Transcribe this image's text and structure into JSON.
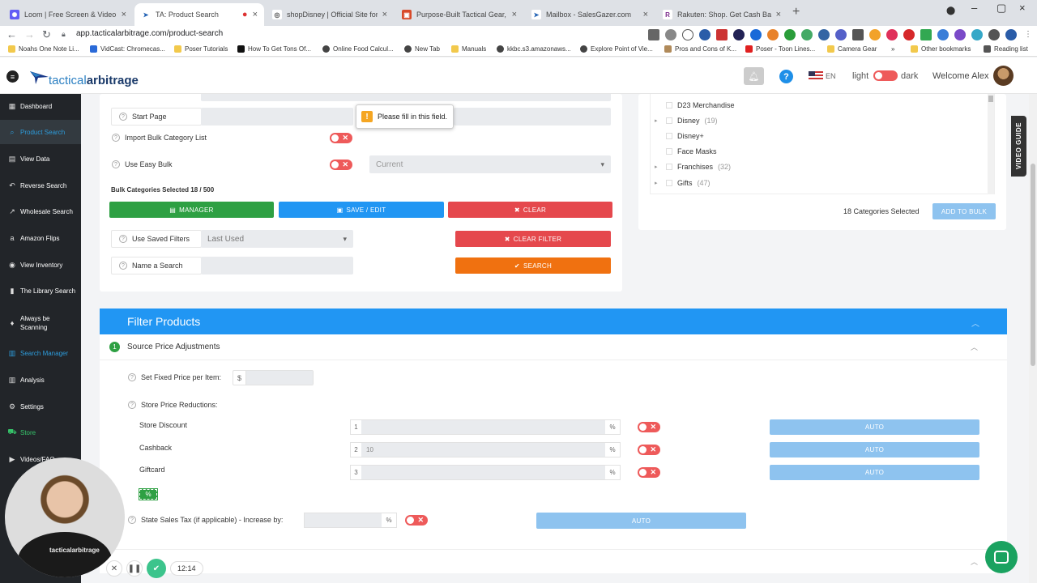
{
  "tabs": [
    {
      "title": "Loom | Free Screen & Video Rec",
      "color": "#625df5",
      "glyph": "✺"
    },
    {
      "title": "TA: Product Search",
      "color": "#1e5fb3",
      "glyph": "➤"
    },
    {
      "title": "shopDisney | Official Site for Disn",
      "color": "#555555",
      "glyph": "◎"
    },
    {
      "title": "Purpose-Built Tactical Gear, Appa",
      "color": "#d84a2a",
      "glyph": "▣"
    },
    {
      "title": "Mailbox - SalesGazer.com",
      "color": "#1e5fb3",
      "glyph": "➤"
    },
    {
      "title": "Rakuten: Shop. Get Cash Back. Re",
      "color": "#7b2a8c",
      "glyph": "R"
    }
  ],
  "browser": {
    "url": "app.tacticalarbitrage.com/product-search",
    "other_bookmarks": "Other bookmarks",
    "reading_list": "Reading list"
  },
  "bookmarks": [
    "Noahs One Note Li...",
    "VidCast: Chromecas...",
    "Poser Tutorials",
    "How To Get Tons Of...",
    "Online Food Calcul...",
    "New Tab",
    "Manuals",
    "kkbc.s3.amazonaws...",
    "Explore Point of Vie...",
    "Pros and Cons of K...",
    "Poser - Toon Lines...",
    "Camera Gear"
  ],
  "header": {
    "logo_a": "tactical",
    "logo_b": "arbitrage",
    "lang": "EN",
    "light": "light",
    "dark": "dark",
    "welcome": "Welcome Alex"
  },
  "sidebar": [
    {
      "label": "Dashboard",
      "icon": "▦"
    },
    {
      "label": "Product Search",
      "icon": "⌕"
    },
    {
      "label": "View Data",
      "icon": "▤"
    },
    {
      "label": "Reverse Search",
      "icon": "↶"
    },
    {
      "label": "Wholesale Search",
      "icon": "↗"
    },
    {
      "label": "Amazon Flips",
      "icon": "a"
    },
    {
      "label": "View Inventory",
      "icon": "◉"
    },
    {
      "label": "The Library Search",
      "icon": "▮"
    },
    {
      "label": "Always be Scanning",
      "icon": "♦"
    },
    {
      "label": "Search Manager",
      "icon": "▥"
    },
    {
      "label": "Analysis",
      "icon": "▥"
    },
    {
      "label": "Settings",
      "icon": "⚙"
    },
    {
      "label": "Store",
      "icon": "⛟"
    },
    {
      "label": "Videos/FAQ",
      "icon": "▶"
    }
  ],
  "search_form": {
    "start_page": "Start Page",
    "import_bulk": "Import Bulk Category List",
    "use_easy_bulk": "Use Easy Bulk",
    "easy_bulk_value": "Current",
    "bulk_selected": "Bulk Categories Selected 18 / 500",
    "manager": "Manager",
    "save_edit": "Save / Edit",
    "clear": "Clear",
    "use_saved_filters": "Use Saved Filters",
    "saved_filter_value": "Last Used",
    "clear_filter": "Clear Filter",
    "name_search": "Name a Search",
    "search": "Search",
    "tooltip": "Please fill in this field."
  },
  "categories": {
    "items": [
      {
        "name": "D23 Merchandise",
        "count": "",
        "expandable": false
      },
      {
        "name": "Disney",
        "count": "(19)",
        "expandable": true
      },
      {
        "name": "Disney+",
        "count": "",
        "expandable": false
      },
      {
        "name": "Face Masks",
        "count": "",
        "expandable": false
      },
      {
        "name": "Franchises",
        "count": "(32)",
        "expandable": true
      },
      {
        "name": "Gifts",
        "count": "(47)",
        "expandable": true
      }
    ],
    "selected_count": "18 Categories Selected",
    "add_to_bulk": "Add to Bulk"
  },
  "filter": {
    "title": "Filter Products",
    "section_num": "1",
    "section_title": "Source Price Adjustments",
    "fixed_price": "Set Fixed Price per Item:",
    "currency": "$",
    "store_reductions": "Store Price Reductions:",
    "rows": [
      {
        "label": "Store Discount",
        "num": "1",
        "value": "",
        "unit": "%",
        "auto": "Auto"
      },
      {
        "label": "Cashback",
        "num": "2",
        "value": "10",
        "unit": "%",
        "auto": "Auto"
      },
      {
        "label": "Giftcard",
        "num": "3",
        "value": "",
        "unit": "%",
        "auto": "Auto"
      }
    ],
    "percent_badge": "%",
    "sales_tax": "State Sales Tax (if applicable) - Increase by:",
    "tax_unit": "%",
    "tax_auto": "Auto"
  },
  "video_guide": "VIDEO GUIDE",
  "recorder": {
    "time": "12:14",
    "shirt_text": "tacticalarbitrage"
  }
}
